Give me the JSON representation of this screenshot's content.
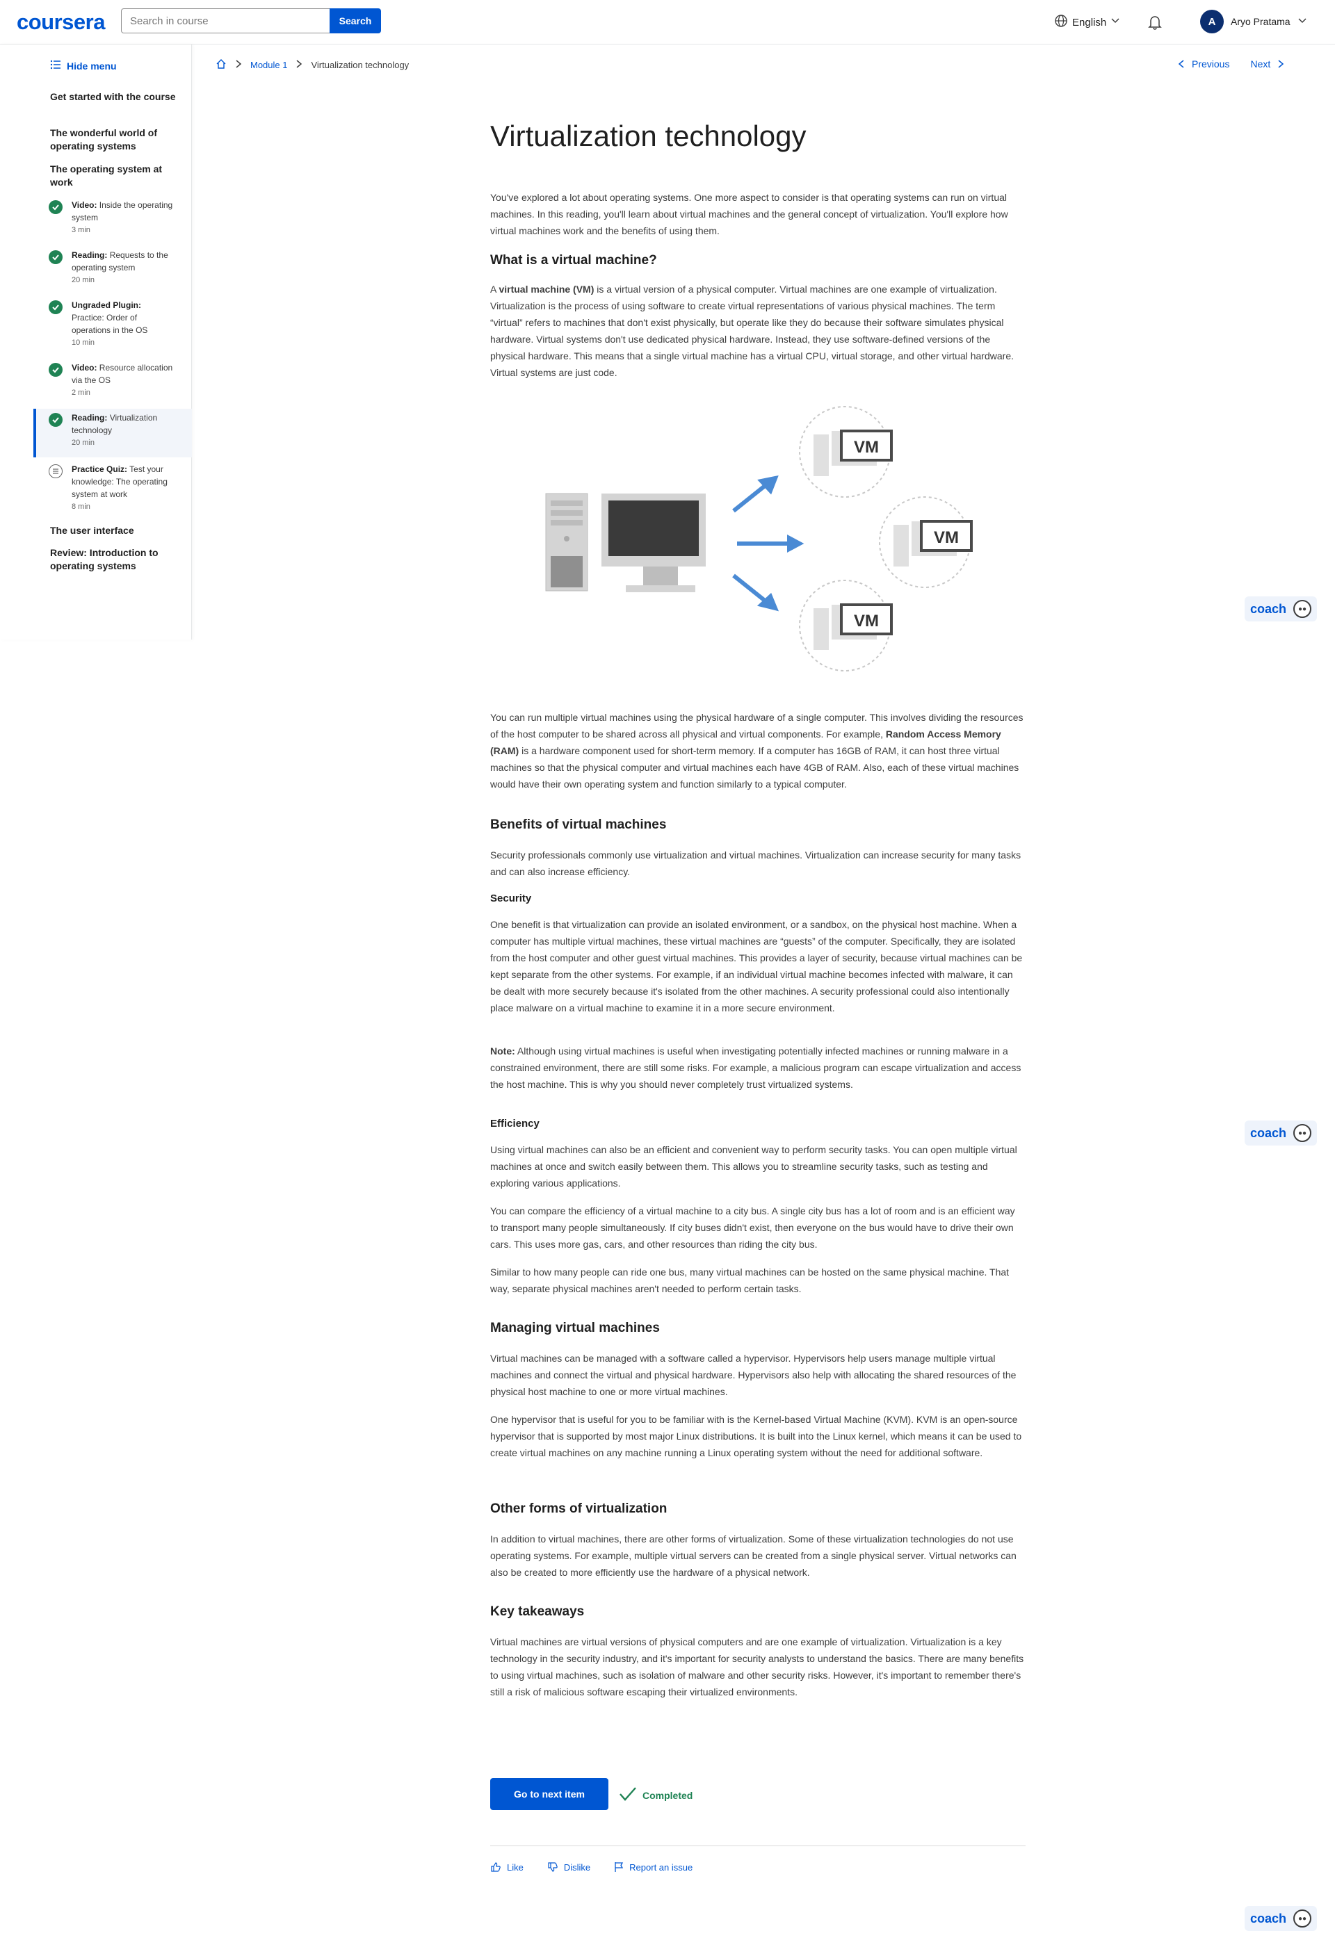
{
  "header": {
    "logo": "coursera",
    "search_placeholder": "Search in course",
    "search_button": "Search",
    "language": "English",
    "user_initial": "A",
    "user_name": "Aryo Pratama"
  },
  "sidebar": {
    "hide_menu": "Hide menu",
    "sections": [
      "Get started with the course",
      "The wonderful world of operating systems",
      "The operating system at work",
      "The user interface",
      "Review: Introduction to operating systems"
    ],
    "items": [
      {
        "type": "Video:",
        "title": "Inside the operating system",
        "time": "3 min"
      },
      {
        "type": "Reading:",
        "title": "Requests to the operating system",
        "time": "20 min"
      },
      {
        "type": "Ungraded Plugin:",
        "title": "Practice: Order of operations in the OS",
        "time": "10 min"
      },
      {
        "type": "Video:",
        "title": "Resource allocation via the OS",
        "time": "2 min"
      },
      {
        "type": "Reading:",
        "title": "Virtualization technology",
        "time": "20 min"
      },
      {
        "type": "Practice Quiz:",
        "title": "Test your knowledge: The operating system at work",
        "time": "8 min"
      }
    ]
  },
  "breadcrumb": {
    "module": "Module 1",
    "current": "Virtualization technology"
  },
  "nav": {
    "previous": "Previous",
    "next": "Next"
  },
  "article": {
    "title": "Virtualization technology",
    "intro": "You've explored a lot about operating systems. One more aspect to consider is that operating systems can run on virtual machines. In this reading, you'll learn about virtual machines and the general concept of virtualization. You'll explore how virtual machines work and the benefits of using them.",
    "h_vm": "What is a virtual machine?",
    "vm_p1_a": "A ",
    "vm_p1_bold": "virtual machine (VM)",
    "vm_p1_b": " is a virtual version of a physical computer. Virtual machines are one example of virtualization. Virtualization is the process of using software to create virtual representations of various physical machines. The term “virtual” refers to machines that don't exist physically, but operate like they do because their software simulates physical hardware. Virtual systems don't use dedicated physical hardware. Instead, they use software-defined versions of the physical hardware. This means that a single virtual machine has a virtual CPU, virtual storage, and other virtual hardware. Virtual systems are just code.",
    "fig_label": "VM",
    "vm_p2_a": "You can run multiple virtual machines using the physical hardware of a single computer. This involves dividing the resources of the host computer to be shared across all physical and virtual components. For example, ",
    "vm_p2_bold": "Random Access Memory (RAM)",
    "vm_p2_b": " is a hardware component used for short-term memory. If a computer has 16GB of RAM, it can host three virtual machines so that the physical computer and virtual machines each have 4GB of RAM. Also, each of these virtual machines would have their own operating system and function similarly to a typical computer.",
    "h_benefits": "Benefits of virtual machines",
    "benefits_p": "Security professionals commonly use virtualization and virtual machines. Virtualization can increase security for many tasks and can also increase efficiency.",
    "h_security": "Security",
    "security_p": "One benefit is that virtualization can provide an isolated environment, or a sandbox, on the physical host machine. When a computer has multiple virtual machines, these virtual machines are “guests” of the computer. Specifically, they are isolated from the host computer and other guest virtual machines. This provides a layer of security, because virtual machines can be kept separate from the other systems. For example, if an individual virtual machine becomes infected with malware, it can be dealt with more securely because it's isolated from the other machines. A security professional could also intentionally place malware on a virtual machine to examine it in a more secure environment.",
    "note_bold": "Note:",
    "note_p": " Although using virtual machines is useful when investigating potentially infected machines or running malware in a constrained environment, there are still some risks. For example, a malicious program can escape virtualization and access the host machine. This is why you should never completely trust virtualized systems.",
    "h_efficiency": "Efficiency",
    "eff_p1": "Using virtual machines can also be an efficient and convenient way to perform security tasks. You can open multiple virtual machines at once and switch easily between them. This allows you to streamline security tasks, such as testing and exploring various applications.",
    "eff_p2": "You can compare the efficiency of a virtual machine to a city bus. A single city bus has a lot of room and is an efficient way to transport many people simultaneously. If city buses didn't exist, then everyone on the bus would have to drive their own cars. This uses more gas, cars, and other resources than riding the city bus.",
    "eff_p3": "Similar to how many people can ride one bus, many virtual machines can be hosted on the same physical machine. That way, separate physical machines aren't needed to perform certain tasks.",
    "h_managing": "Managing virtual machines",
    "man_p1": "Virtual machines can be managed with a software called a hypervisor. Hypervisors help users manage multiple virtual machines and connect the virtual and physical hardware. Hypervisors also help with allocating the shared resources of the physical host machine to one or more virtual machines.",
    "man_p2": "One hypervisor that is useful for you to be familiar with is the Kernel-based Virtual Machine (KVM). KVM is an open-source hypervisor that is supported by most major Linux distributions. It is built into the Linux kernel, which means it can be used to create virtual machines on any machine running a Linux operating system without the need for additional software.",
    "h_other": "Other forms of virtualization",
    "other_p": "In addition to virtual machines, there are other forms of virtualization. Some of these virtualization technologies do not use operating systems. For example, multiple virtual servers can be created from a single physical server. Virtual networks can also be created to more efficiently use the hardware of a physical network.",
    "h_takeaways": "Key takeaways",
    "takeaways_p": "Virtual machines are virtual versions of physical computers and are one example of virtualization. Virtualization is a key technology in the security industry, and it's important for security analysts to understand the basics. There are many benefits to using virtual machines, such as isolation of malware and other security risks. However, it's important to remember there's still a risk of malicious software escaping their virtualized environments."
  },
  "actions": {
    "next_item": "Go to next item",
    "completed": "Completed",
    "like": "Like",
    "dislike": "Dislike",
    "report": "Report an issue"
  },
  "coach_label": "coach",
  "colors": {
    "brand": "#0056d2",
    "success": "#1f8354"
  }
}
